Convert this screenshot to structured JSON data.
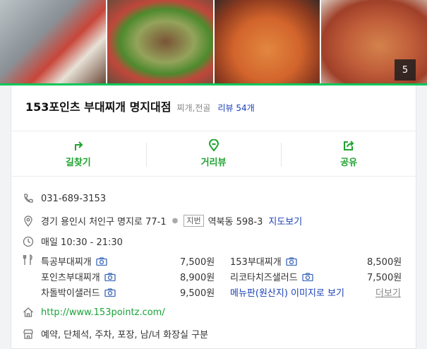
{
  "photos": {
    "count": "5"
  },
  "place": {
    "name": "153포인츠 부대찌개 명지대점",
    "category": "찌개,전골",
    "reviews": "리뷰 54개"
  },
  "actions": [
    {
      "label": "길찾기",
      "icon": "directions-icon"
    },
    {
      "label": "거리뷰",
      "icon": "street-view-icon"
    },
    {
      "label": "공유",
      "icon": "share-icon"
    }
  ],
  "info": {
    "phone": "031-689-3153",
    "address": "경기 용인시 처인구 명지로 77-1",
    "jibun_tag": "지번",
    "jibun": "역북동 598-3",
    "map_link": "지도보기",
    "hours": "매일 10:30 - 21:30",
    "url": "http://www.153pointz.com/",
    "amenities": "예약, 단체석, 주차, 포장, 남/녀 화장실 구분"
  },
  "menu": {
    "left": [
      {
        "name": "특공부대찌개",
        "price": "7,500원"
      },
      {
        "name": "포인츠부대찌개",
        "price": "8,900원"
      },
      {
        "name": "차돌박이샐러드",
        "price": "9,500원"
      }
    ],
    "right": [
      {
        "name": "153부대찌개",
        "price": "8,500원"
      },
      {
        "name": "리코타치즈샐러드",
        "price": "7,500원"
      }
    ],
    "photo_link": "메뉴판(원산지) 이미지로 보기",
    "more": "더보기"
  },
  "colors": {
    "accent": "#03c75a",
    "link": "#1a3fb8",
    "action": "#1fa32f"
  }
}
